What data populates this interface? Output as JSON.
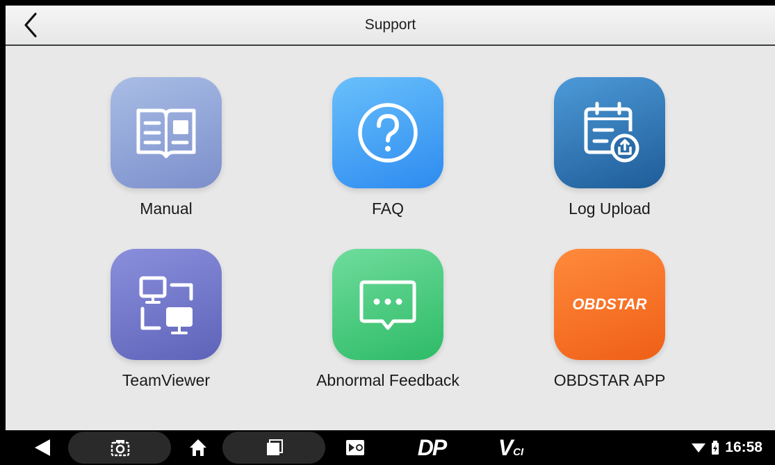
{
  "header": {
    "title": "Support",
    "back_icon": "chevron-left-icon"
  },
  "tiles": [
    {
      "label": "Manual",
      "icon": "book-icon",
      "color": "#8ea3d6"
    },
    {
      "label": "FAQ",
      "icon": "question-circle-icon",
      "color": "#3b9cf6"
    },
    {
      "label": "Log Upload",
      "icon": "log-upload-icon",
      "color": "#2c6fae"
    },
    {
      "label": "TeamViewer",
      "icon": "teamviewer-icon",
      "color": "#6f74cc"
    },
    {
      "label": "Abnormal Feedback",
      "icon": "chat-bubble-icon",
      "color": "#3fc87a"
    },
    {
      "label": "OBDSTAR APP",
      "icon": "obdstar-logo-icon",
      "color": "#f5701f",
      "logo_text": "OBDSTAR"
    }
  ],
  "navbar": {
    "items": [
      "back-triangle-icon",
      "screenshot-icon",
      "home-icon",
      "recents-icon",
      "quick-tool-icon",
      "dp-icon",
      "vci-icon"
    ],
    "dp_label": "DP",
    "vci_label": "V",
    "vci_sub": "CI"
  },
  "status": {
    "time": "16:58",
    "wifi": "wifi-icon",
    "battery": "battery-icon"
  }
}
